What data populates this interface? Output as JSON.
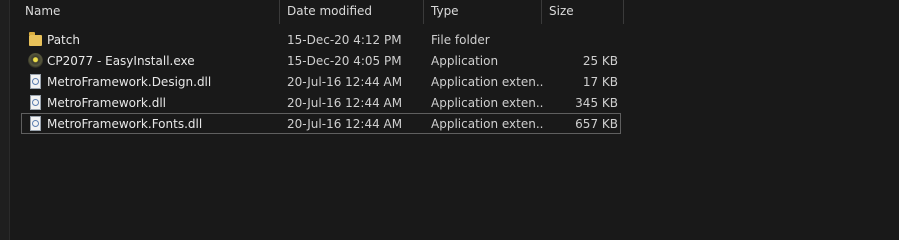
{
  "columns": {
    "name": "Name",
    "date": "Date modified",
    "type": "Type",
    "size": "Size"
  },
  "sort_indicator": "^",
  "files": [
    {
      "name": "Patch",
      "date": "15-Dec-20 4:12 PM",
      "type": "File folder",
      "size": "",
      "icon": "folder-icon"
    },
    {
      "name": "CP2077 - EasyInstall.exe",
      "date": "15-Dec-20 4:05 PM",
      "type": "Application",
      "size": "25 KB",
      "icon": "app-icon"
    },
    {
      "name": "MetroFramework.Design.dll",
      "date": "20-Jul-16 12:44 AM",
      "type": "Application exten...",
      "size": "17 KB",
      "icon": "dll-icon"
    },
    {
      "name": "MetroFramework.dll",
      "date": "20-Jul-16 12:44 AM",
      "type": "Application exten...",
      "size": "345 KB",
      "icon": "dll-icon"
    },
    {
      "name": "MetroFramework.Fonts.dll",
      "date": "20-Jul-16 12:44 AM",
      "type": "Application exten...",
      "size": "657 KB",
      "icon": "dll-icon"
    }
  ],
  "colors": {
    "background": "#191919",
    "folder": "#e8c15a",
    "focus_border": "#5f5f5f"
  }
}
